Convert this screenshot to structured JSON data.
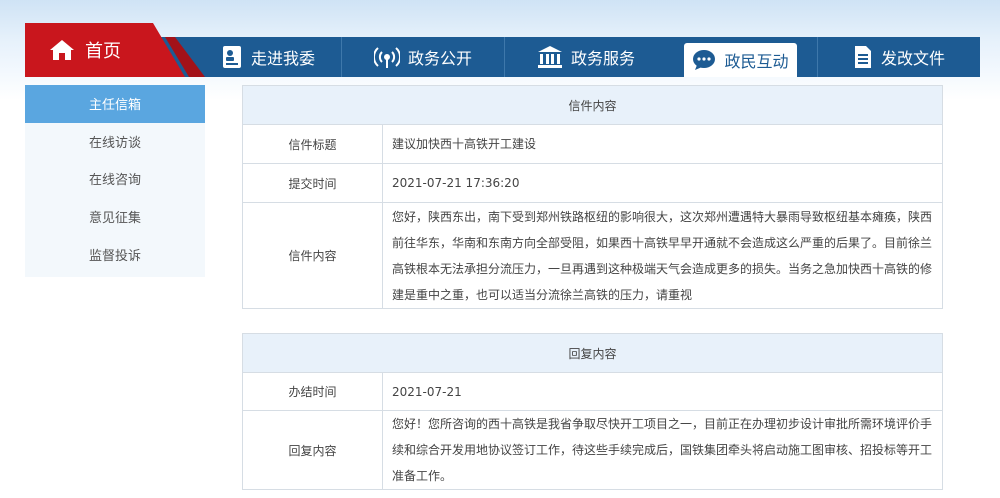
{
  "nav": {
    "home_label": "首页",
    "tabs": [
      {
        "label": "走进我委",
        "icon": "person-card-icon"
      },
      {
        "label": "政务公开",
        "icon": "broadcast-icon"
      },
      {
        "label": "政务服务",
        "icon": "building-icon"
      },
      {
        "label": "政民互动",
        "icon": "chat-bubble-icon"
      },
      {
        "label": "发改文件",
        "icon": "document-icon"
      }
    ],
    "active_tab": "政民互动"
  },
  "sidebar": {
    "items": [
      {
        "label": "主任信箱"
      },
      {
        "label": "在线访谈"
      },
      {
        "label": "在线咨询"
      },
      {
        "label": "意见征集"
      },
      {
        "label": "监督投诉"
      }
    ],
    "active_item": "主任信箱"
  },
  "letter": {
    "header": "信件内容",
    "title_label": "信件标题",
    "title_value": "建议加快西十高铁开工建设",
    "time_label": "提交时间",
    "time_value": "2021-07-21 17:36:20",
    "content_label": "信件内容",
    "content_value": "您好，陕西东出，南下受到郑州铁路枢纽的影响很大，这次郑州遭遇特大暴雨导致枢纽基本瘫痪，陕西前往华东，华南和东南方向全部受阻，如果西十高铁早早开通就不会造成这么严重的后果了。目前徐兰高铁根本无法承担分流压力，一旦再遇到这种极端天气会造成更多的损失。当务之急加快西十高铁的修建是重中之重，也可以适当分流徐兰高铁的压力，请重视"
  },
  "reply": {
    "header": "回复内容",
    "date_label": "办结时间",
    "date_value": "2021-07-21",
    "content_label": "回复内容",
    "content_value": "您好！您所咨询的西十高铁是我省争取尽快开工项目之一，目前正在办理初步设计审批所需环境评价手续和综合开发用地协议签订工作，待这些手续完成后，国铁集团牵头将启动施工图审核、招投标等开工准备工作。"
  },
  "colors": {
    "nav_blue": "#1d5b93",
    "home_red": "#c9161d",
    "sidebar_active": "#5aa6e0",
    "table_header_bg": "#e8f1fa"
  }
}
